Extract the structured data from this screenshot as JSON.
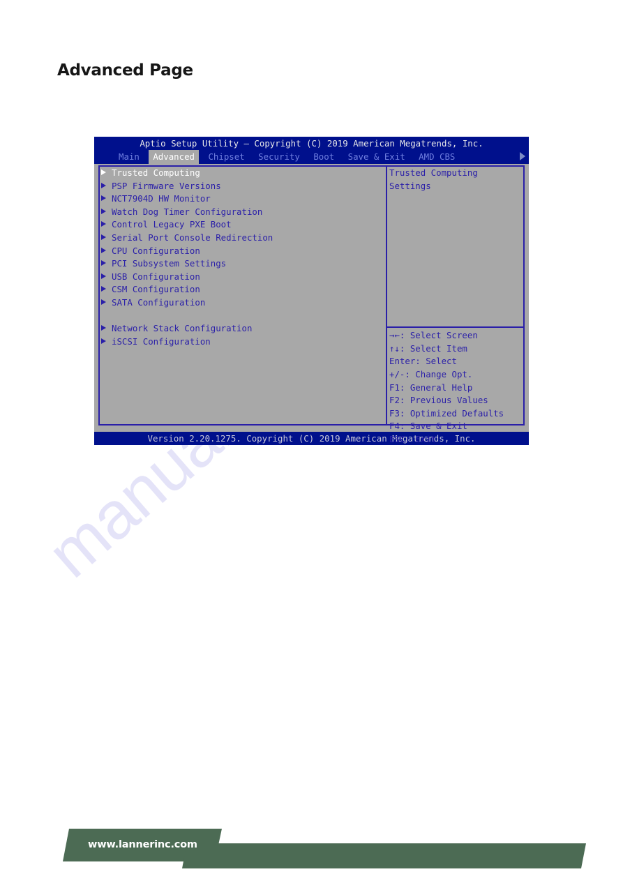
{
  "page": {
    "title": "Advanced Page"
  },
  "watermark": {
    "text": "manualshive.com"
  },
  "bios": {
    "titlebar": "Aptio Setup Utility – Copyright (C) 2019 American Megatrends, Inc.",
    "tabs": [
      {
        "label": "Main",
        "active": false
      },
      {
        "label": "Advanced",
        "active": true
      },
      {
        "label": "Chipset",
        "active": false
      },
      {
        "label": "Security",
        "active": false
      },
      {
        "label": "Boot",
        "active": false
      },
      {
        "label": "Save & Exit",
        "active": false
      },
      {
        "label": "AMD CBS",
        "active": false
      }
    ],
    "scroll_arrow_icon": "chevron-right-icon",
    "menu_items": [
      {
        "label": "Trusted Computing",
        "selected": true,
        "spacer": false
      },
      {
        "label": "PSP Firmware Versions",
        "selected": false,
        "spacer": false
      },
      {
        "label": "NCT7904D HW Monitor",
        "selected": false,
        "spacer": false
      },
      {
        "label": "Watch Dog Timer Configuration",
        "selected": false,
        "spacer": false
      },
      {
        "label": "Control Legacy PXE Boot",
        "selected": false,
        "spacer": false
      },
      {
        "label": "Serial Port Console Redirection",
        "selected": false,
        "spacer": false
      },
      {
        "label": "CPU Configuration",
        "selected": false,
        "spacer": false
      },
      {
        "label": "PCI Subsystem Settings",
        "selected": false,
        "spacer": false
      },
      {
        "label": "USB Configuration",
        "selected": false,
        "spacer": false
      },
      {
        "label": "CSM Configuration",
        "selected": false,
        "spacer": false
      },
      {
        "label": "SATA Configuration",
        "selected": false,
        "spacer": false
      },
      {
        "label": "",
        "selected": false,
        "spacer": true
      },
      {
        "label": "Network Stack Configuration",
        "selected": false,
        "spacer": false
      },
      {
        "label": "iSCSI Configuration",
        "selected": false,
        "spacer": false
      }
    ],
    "help_text_lines": [
      "Trusted Computing",
      "Settings"
    ],
    "key_legend": [
      "→←: Select Screen",
      "↑↓: Select Item",
      "Enter: Select",
      "+/-: Change Opt.",
      "F1: General Help",
      "F2: Previous Values",
      "F3: Optimized Defaults",
      "F4: Save & Exit",
      "ESC: Exit"
    ],
    "statusbar": "Version 2.20.1275. Copyright (C) 2019 American Megatrends, Inc."
  },
  "footer": {
    "site_url": "www.lannerinc.com"
  },
  "colors": {
    "bios_blue": "#00108c",
    "bios_gray": "#a8a8a8",
    "bios_text_blue": "#2a1fa8",
    "bios_tab_inactive": "#6f7fe0",
    "selected_text": "#ffffff",
    "footer_green": "#4c6b54",
    "watermark": "#3b33cc"
  }
}
